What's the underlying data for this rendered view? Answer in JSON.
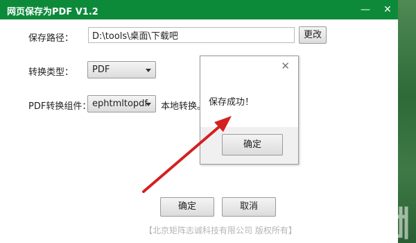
{
  "window": {
    "title": "网页保存为PDF  V1.2",
    "minimize_glyph": "—",
    "close_glyph": "✕"
  },
  "form": {
    "save_path_label": "保存路径：",
    "save_path_value": "D:\\tools\\桌面\\下载吧",
    "change_button": "更改",
    "convert_type_label": "转换类型：",
    "convert_type_value": "PDF",
    "component_label": "PDF转换组件：",
    "component_value": "ephtmltopdf",
    "component_note": "本地转换。"
  },
  "dialog": {
    "message": "保存成功！",
    "ok_button": "确定",
    "close_glyph": "✕"
  },
  "footer": {
    "ok_button": "确定",
    "cancel_button": "取消",
    "copyright": "【北京矩阵志诚科技有限公司 版权所有】"
  },
  "colors": {
    "titlebar": "#0c8a3a",
    "arrow": "#d42020"
  },
  "icons": [
    "minimize-icon",
    "close-icon",
    "dropdown-caret-icon",
    "annotation-arrow",
    "watermark-logo"
  ]
}
